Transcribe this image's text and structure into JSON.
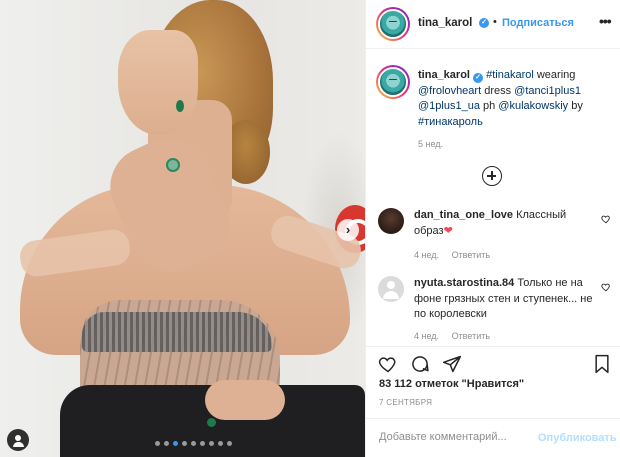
{
  "post": {
    "username": "tina_karol",
    "follow_label": "Подписаться",
    "bullet": "•",
    "more_label": "•••"
  },
  "caption": {
    "username": "tina_karol",
    "segments": [
      {
        "text": "#tinakarol",
        "link": true
      },
      {
        "text": " wearing ",
        "link": false
      },
      {
        "text": "@frolovheart",
        "link": true
      },
      {
        "text": " dress ",
        "link": false
      },
      {
        "text": "@tanci1plus1",
        "link": true
      },
      {
        "text": " ",
        "link": false
      },
      {
        "text": "@1plus1_ua",
        "link": true
      },
      {
        "text": " ph ",
        "link": false
      },
      {
        "text": "@kulakowskiy",
        "link": true
      },
      {
        "text": " by ",
        "link": false
      },
      {
        "text": "#тинакароль",
        "link": true
      }
    ],
    "time": "5 нед."
  },
  "comments": [
    {
      "username": "dan_tina_one_love",
      "text": "Классный образ",
      "emoji": "❤",
      "time": "4 нед.",
      "reply_label": "Ответить"
    },
    {
      "username": "nyuta.starostina.84",
      "text": "Только не на фоне грязных стен и ступенек... не по королевски",
      "time": "4 нед.",
      "reply_label": "Ответить"
    }
  ],
  "likes_text": "83 112 отметок \"Нравится\"",
  "date_text": "7 СЕНТЯБРЯ",
  "comment_input": {
    "placeholder": "Добавьте комментарий...",
    "publish_label": "Опубликовать"
  },
  "colors": {
    "accent": "#3897f0",
    "link": "#00376b",
    "muted": "#8e8e8e",
    "publish_disabled": "#b2dffc",
    "heart_red": "#ed4956"
  },
  "icons": {
    "next_arrow": "chevron-right-icon",
    "tag": "user-tag-icon",
    "like": "heart-icon",
    "comment": "comment-icon",
    "share": "paper-plane-icon",
    "save": "bookmark-icon",
    "load_more": "plus-circle-icon",
    "comment_like": "heart-icon"
  },
  "carousel": {
    "total": 9,
    "active": 2
  }
}
